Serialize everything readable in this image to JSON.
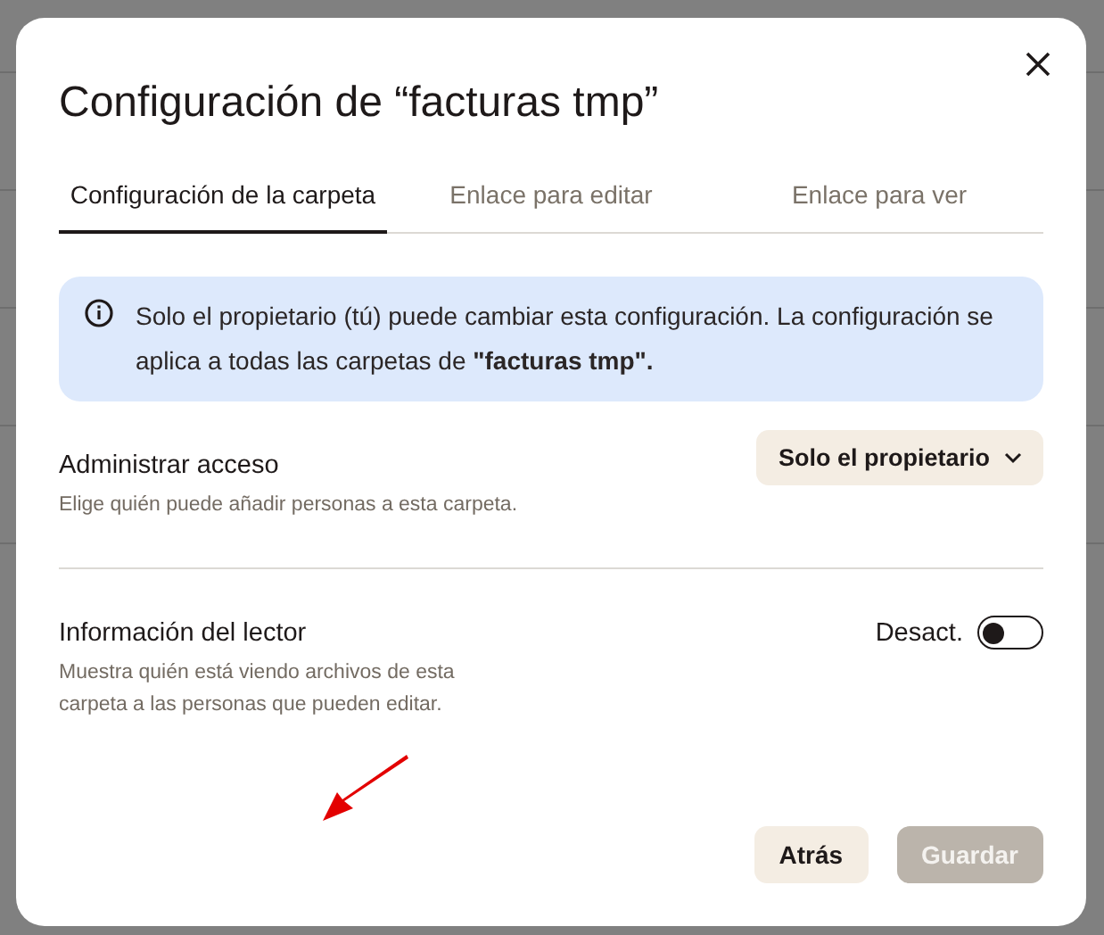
{
  "dialog": {
    "title": "Configuración de “facturas tmp”",
    "tabs": [
      {
        "label": "Configuración de la carpeta",
        "selected": true
      },
      {
        "label": "Enlace para editar",
        "selected": false
      },
      {
        "label": "Enlace para ver",
        "selected": false
      }
    ],
    "notice": "Solo el propietario (tú) puede cambiar esta configuración. La configuración se aplica a todas las carpetas de **\"facturas tmp\".**",
    "settings": [
      {
        "kind": "dropdown",
        "title": "Administrar acceso",
        "description": "Elige quién puede añadir personas a esta carpeta.",
        "value": "Solo el propietario"
      },
      {
        "kind": "toggle",
        "title": "Información del lector",
        "description": "Muestra quién está viendo archivos de esta carpeta a las personas que pueden editar.",
        "state_label": "Desact.",
        "on": false
      }
    ],
    "buttons": [
      {
        "label": "Atrás",
        "disabled": false
      },
      {
        "label": "Guardar",
        "disabled": true
      }
    ]
  }
}
